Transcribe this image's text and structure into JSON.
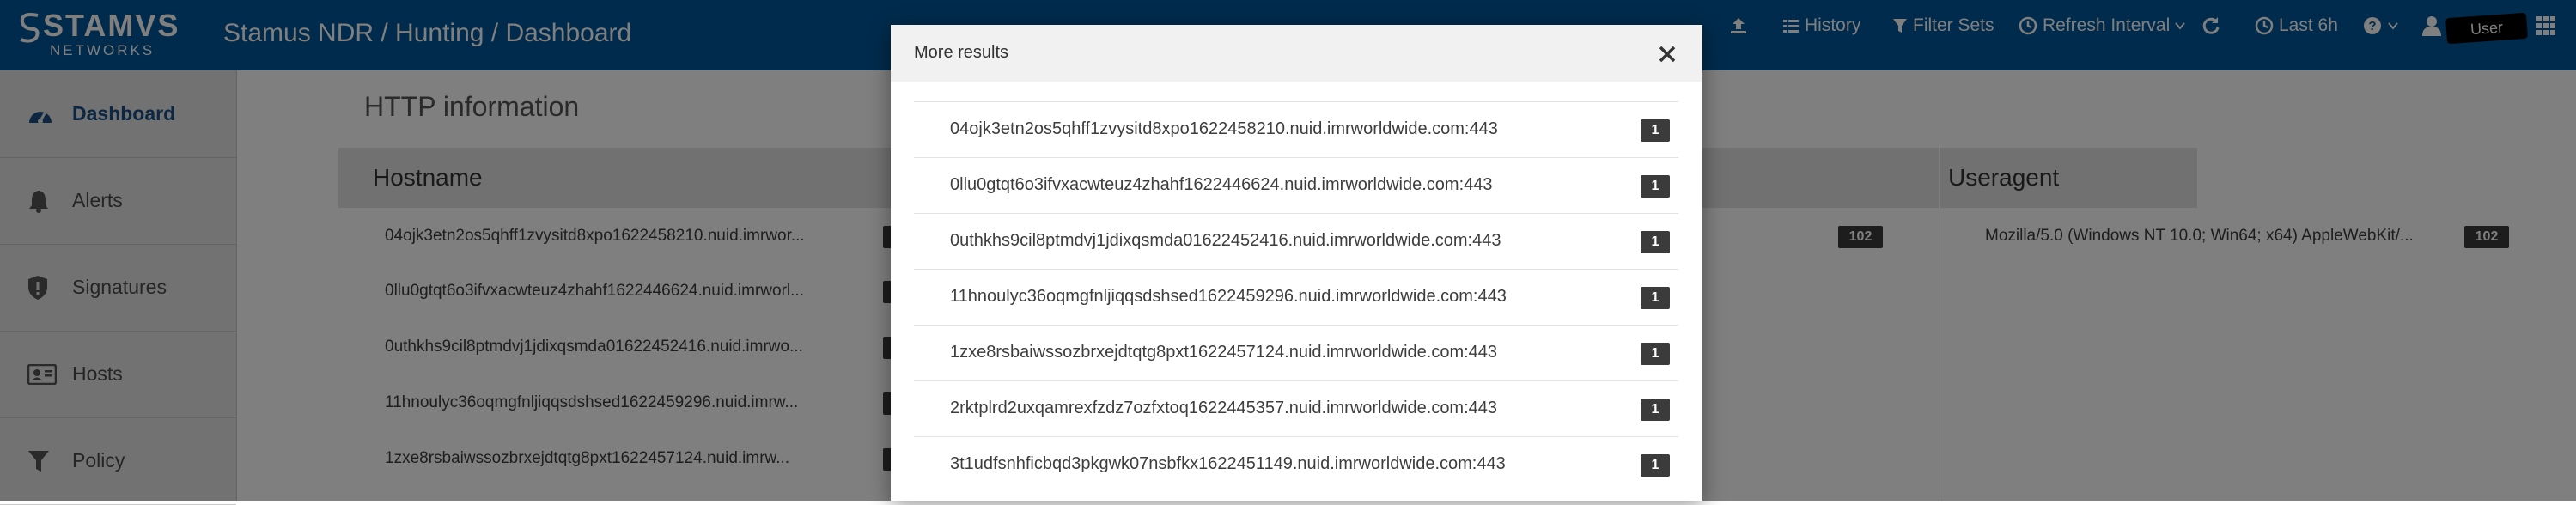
{
  "header": {
    "logo_main": "STAMVS",
    "logo_sub": "NETWORKS",
    "title": "Stamus NDR / Hunting / Dashboard",
    "actions": {
      "history": "History",
      "filter_sets": "Filter Sets",
      "refresh_interval": "Refresh Interval",
      "time_range": "Last 6h"
    },
    "user_label": "User"
  },
  "sidebar": {
    "items": [
      {
        "label": "Dashboard",
        "icon": "dashboard-icon",
        "active": true
      },
      {
        "label": "Alerts",
        "icon": "bell-icon"
      },
      {
        "label": "Signatures",
        "icon": "shield-icon"
      },
      {
        "label": "Hosts",
        "icon": "id-card-icon"
      },
      {
        "label": "Policy",
        "icon": "filter-icon"
      }
    ]
  },
  "main": {
    "section_title": "HTTP information",
    "hostname_panel": {
      "header": "Hostname",
      "rows": [
        "04ojk3etn2os5qhff1zvysitd8xpo1622458210.nuid.imrwor...",
        "0llu0gtqt6o3ifvxacwteuz4zhahf1622446624.nuid.imrworl...",
        "0uthkhs9cil8ptmdvj1jdixqsmda01622452416.nuid.imrwo...",
        "11hnoulyc36oqmgfnljiqqsdshsed1622459296.nuid.imrw...",
        "1zxe8rsbaiwssozbrxejdtqtg8pxt1622457124.nuid.imrw..."
      ]
    },
    "middle_panel": {
      "count": "102"
    },
    "useragent_panel": {
      "header": "Useragent",
      "row": {
        "value": "Mozilla/5.0 (Windows NT 10.0; Win64; x64) AppleWebKit/...",
        "count": "102"
      }
    }
  },
  "modal": {
    "title": "More results",
    "rows": [
      {
        "host": "04ojk3etn2os5qhff1zvysitd8xpo1622458210.nuid.imrworldwide.com:443",
        "count": "1"
      },
      {
        "host": "0llu0gtqt6o3ifvxacwteuz4zhahf1622446624.nuid.imrworldwide.com:443",
        "count": "1"
      },
      {
        "host": "0uthkhs9cil8ptmdvj1jdixqsmda01622452416.nuid.imrworldwide.com:443",
        "count": "1"
      },
      {
        "host": "11hnoulyc36oqmgfnljiqqsdshsed1622459296.nuid.imrworldwide.com:443",
        "count": "1"
      },
      {
        "host": "1zxe8rsbaiwssozbrxejdtqtg8pxt1622457124.nuid.imrworldwide.com:443",
        "count": "1"
      },
      {
        "host": "2rktplrd2uxqamrexfzdz7ozfxtoq1622445357.nuid.imrworldwide.com:443",
        "count": "1"
      },
      {
        "host": "3t1udfsnhficbqd3pkgwk07nsbfkx1622451149.nuid.imrworldwide.com:443",
        "count": "1"
      }
    ]
  },
  "colors": {
    "topbar": "#005798",
    "sidebar_bg": "#e5e5e5",
    "active_item": "#1a4f85",
    "badge": "#3b3b3b",
    "overlay": "rgba(0,0,0,0.5)"
  }
}
